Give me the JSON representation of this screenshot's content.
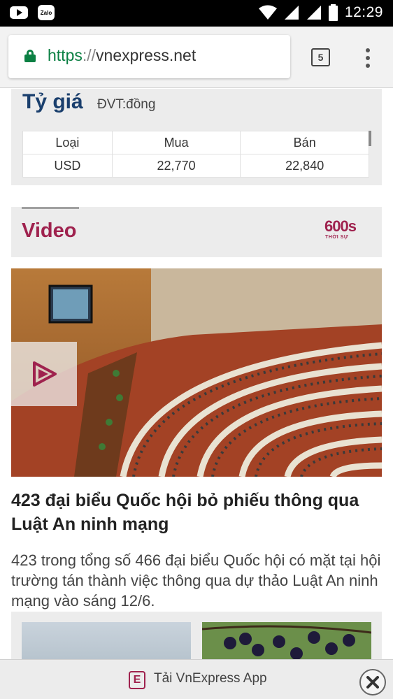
{
  "status_bar": {
    "time": "12:29",
    "zalo_label": "Zalo"
  },
  "browser": {
    "url_scheme": "https",
    "url_sep": "://",
    "url_host": "vnexpress.net",
    "tab_count": "5"
  },
  "exchange": {
    "title": "Tỷ giá",
    "unit": "ĐVT:đồng",
    "headers": [
      "Loại",
      "Mua",
      "Bán"
    ],
    "rows": [
      {
        "type": "USD",
        "buy": "22,770",
        "sell": "22,840"
      }
    ]
  },
  "video": {
    "title": "Video",
    "logo_number": "600s",
    "logo_sub": "THỜI SỰ"
  },
  "article": {
    "headline": "423 đại biểu Quốc hội bỏ phiếu thông qua Luật An ninh mạng",
    "description": "423 trong tổng số 466 đại biểu Quốc hội có mặt tại hội trường tán thành việc thông qua dự thảo Luật An ninh mạng vào sáng 12/6."
  },
  "app_banner": {
    "text": "Tải VnExpress App",
    "logo_letter": "E"
  },
  "colors": {
    "brand": "#9f224e",
    "secure": "#0b8043",
    "navy": "#1a3f6d"
  }
}
